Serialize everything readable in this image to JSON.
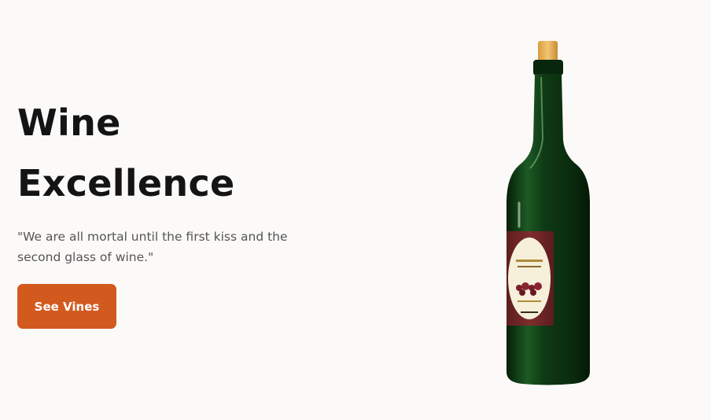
{
  "hero": {
    "title_line_1": "Wine",
    "title_line_2": "Excellence",
    "quote": "\"We are all mortal until the first kiss and the second glass of wine.\"",
    "cta_label": "See Vines"
  },
  "image": {
    "icon": "wine-bottle-icon"
  },
  "colors": {
    "background": "#fcfaf8",
    "accent": "#d35a1f",
    "title": "#141414",
    "body_text": "#555555",
    "bottle_glass": "#0f3a14",
    "label_red": "#7a2a2a",
    "cork": "#e8b860"
  }
}
